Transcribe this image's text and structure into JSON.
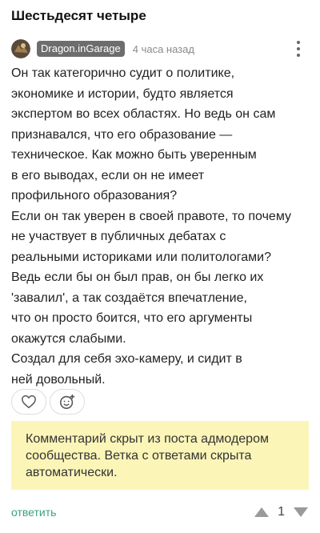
{
  "post": {
    "title": "Шестьдесят четыре"
  },
  "comment": {
    "author": "Dragon.inGarage",
    "time": "4 часа назад",
    "lines": [
      "Он так категорично судит о политике,",
      "экономике и истории, будто является",
      "экспертом во всех областях. Но ведь он сам",
      "признавался, что его образование —",
      "техническое. Как можно быть уверенным",
      "в его выводах, если он не имеет",
      "профильного образования?",
      "Если он так уверен в своей правоте, то почему",
      "не участвует в публичных дебатах с",
      "реальными историками или политологами?",
      "Ведь если бы он был прав, он бы легко их",
      "'завалил', а так создаётся впечатление,",
      "что он просто боится, что его аргументы",
      "окажутся слабыми.",
      "Создал для себя эхо-камеру, и сидит в",
      "ней довольный."
    ],
    "notice": "Комментарий скрыт из поста адмодером сообщества. Ветка с ответами скрыта автоматически.",
    "reply_label": "ответить",
    "score": "1"
  },
  "icons": {
    "more": "more-vertical-icon",
    "like": "heart-icon",
    "reaction": "add-emoji-icon",
    "upvote": "triangle-up-icon",
    "downvote": "triangle-down-icon"
  },
  "colors": {
    "notice_bg": "#fcf5b8",
    "reply": "#3aa37a",
    "username_bg": "#6d6d6d",
    "vote_arrow": "#9a9a9a"
  }
}
